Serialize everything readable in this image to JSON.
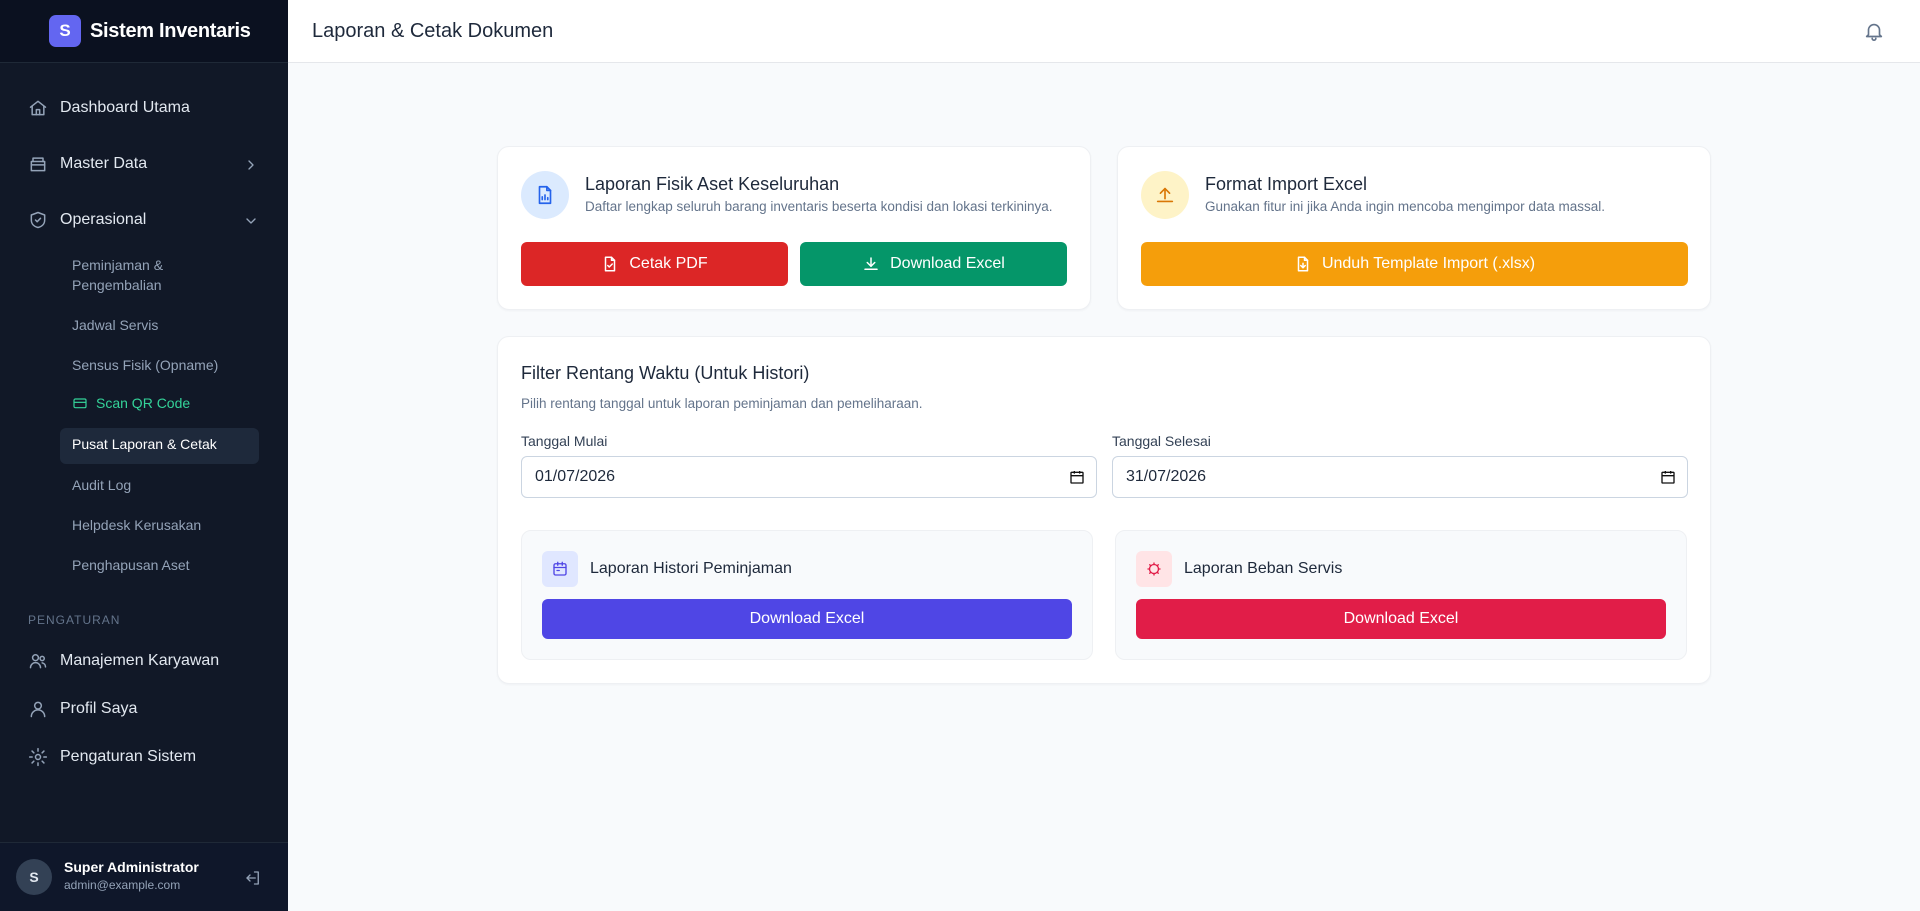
{
  "brand": {
    "logo_letter": "S",
    "name": "Sistem Inventaris"
  },
  "sidebar": {
    "items": [
      {
        "label": "Dashboard Utama",
        "icon": "home-icon"
      },
      {
        "label": "Master Data",
        "icon": "box-icon"
      },
      {
        "label": "Operasional",
        "icon": "shield-icon"
      }
    ],
    "operasional_sub": [
      {
        "label": "Peminjaman & Pengembalian"
      },
      {
        "label": "Jadwal Servis"
      },
      {
        "label": "Sensus Fisik (Opname)"
      },
      {
        "label": "Scan QR Code",
        "icon": "card-icon"
      },
      {
        "label": "Pusat Laporan & Cetak"
      },
      {
        "label": "Audit Log"
      },
      {
        "label": "Helpdesk Kerusakan"
      },
      {
        "label": "Penghapusan Aset"
      }
    ],
    "settings_section": "PENGATURAN",
    "settings_items": [
      {
        "label": "Manajemen Karyawan",
        "icon": "users-icon"
      },
      {
        "label": "Profil Saya",
        "icon": "user-icon"
      },
      {
        "label": "Pengaturan Sistem",
        "icon": "gear-icon"
      }
    ],
    "user": {
      "initial": "S",
      "name": "Super Administrator",
      "email": "admin@example.com"
    }
  },
  "header": {
    "title": "Laporan & Cetak Dokumen"
  },
  "report_card": {
    "title": "Laporan Fisik Aset Keseluruhan",
    "description": "Daftar lengkap seluruh barang inventaris beserta kondisi dan lokasi terkininya.",
    "pdf_label": "Cetak PDF",
    "excel_label": "Download Excel"
  },
  "import_card": {
    "title": "Format Import Excel",
    "description": "Gunakan fitur ini jika Anda ingin mencoba mengimpor data massal.",
    "template_label": "Unduh Template Import (.xlsx)"
  },
  "filter": {
    "title": "Filter Rentang Waktu (Untuk Histori)",
    "description": "Pilih rentang tanggal untuk laporan peminjaman dan pemeliharaan.",
    "start_label": "Tanggal Mulai",
    "start_value": "01/07/2026",
    "end_label": "Tanggal Selesai",
    "end_value": "31/07/2026",
    "loan_report": {
      "title": "Laporan Histori Peminjaman",
      "button": "Download Excel"
    },
    "service_report": {
      "title": "Laporan Beban Servis",
      "button": "Download Excel"
    }
  },
  "colors": {
    "sidebar_bg": "#111827",
    "red": "#dc2626",
    "green": "#059669",
    "amber": "#f59e0b",
    "indigo": "#4f46e5",
    "rose": "#e11d48",
    "emerald_text": "#34d399"
  }
}
